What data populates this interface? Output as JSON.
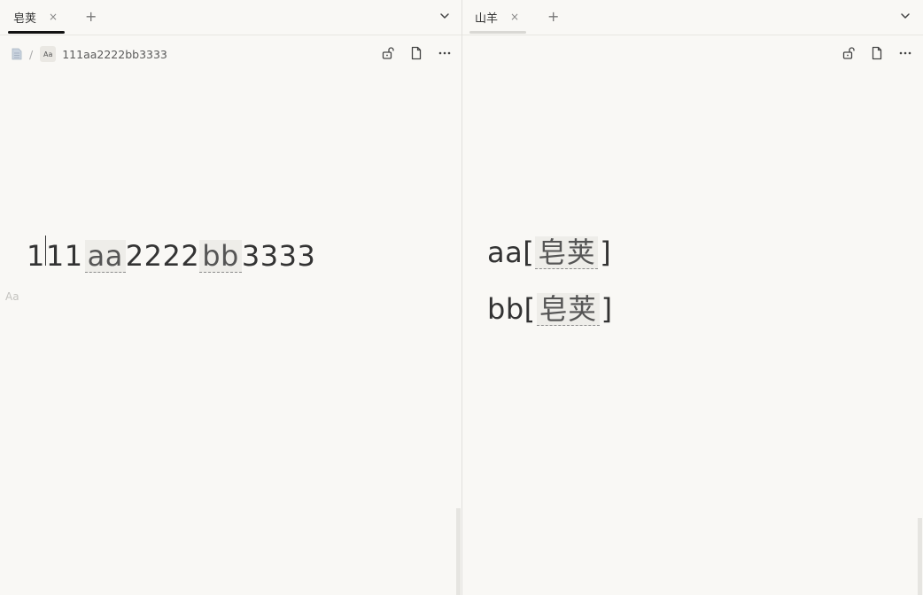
{
  "left_pane": {
    "tab": {
      "label": "皂荚",
      "close": "×"
    },
    "add_tab": "+",
    "breadcrumb": {
      "separator": "/",
      "doc_icon": "aa-badge-icon",
      "doc_badge": "Aa",
      "title": "111aa2222bb3333"
    },
    "editor": {
      "segments": {
        "s1": "1",
        "s2": "11",
        "ref1": "aa",
        "s3": "2222",
        "ref2": "bb",
        "s4": "3333"
      },
      "gutter_label": "Aa"
    }
  },
  "right_pane": {
    "tab": {
      "label": "山羊",
      "close": "×"
    },
    "add_tab": "+",
    "editor": {
      "line1": {
        "prefix": "aa[",
        "ref": "皂荚",
        "suffix": "]"
      },
      "line2": {
        "prefix": "bb[",
        "ref": "皂荚",
        "suffix": "]"
      }
    }
  },
  "icons": {
    "lock": "unlock-icon",
    "file": "file-icon",
    "more": "more-icon",
    "chevron": "chevron-down-icon"
  },
  "colors": {
    "background": "#f9f8f5",
    "active_tab_underline": "#111111",
    "inactive_tab_underline": "#d9d8d4",
    "ref_background": "#eeede9"
  }
}
